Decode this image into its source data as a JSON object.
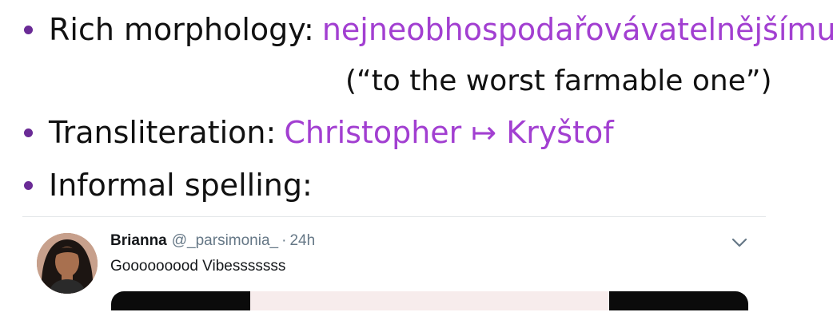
{
  "bullets": [
    {
      "label": "Rich morphology:",
      "example": "nejneobhospodařovávatelnějšímu"
    },
    {
      "label": "Transliteration:",
      "example": "Christopher ↦ Kryštof"
    },
    {
      "label": "Informal spelling:",
      "example": ""
    }
  ],
  "gloss": "(“to the worst farmable one”)",
  "tweet": {
    "author": "Brianna",
    "handle": "@_parsimonia_",
    "separator": "·",
    "time": "24h",
    "text": "Gooooooood Vibesssssss",
    "avatar_icon": "user-avatar",
    "menu_icon": "chevron-down-icon"
  },
  "colors": {
    "accent": "#a23fd1",
    "bullet": "#6a2b96",
    "text": "#111111",
    "secondary": "#657786"
  }
}
